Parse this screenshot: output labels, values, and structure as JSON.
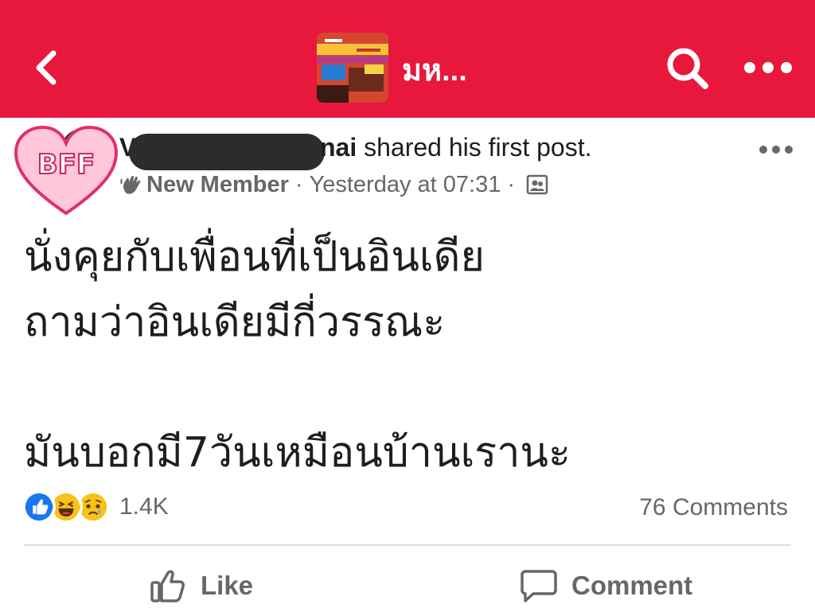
{
  "header": {
    "group_title": "มห...",
    "colors": {
      "bar": "#e8173c",
      "icon": "#ffffff"
    },
    "icons": [
      "back-chevron-icon",
      "search-icon",
      "more-icon"
    ]
  },
  "post": {
    "avatar_text": "BFF",
    "author_start": "V",
    "author_end": "nai",
    "shared_text": " shared his first post.",
    "badge": "New Member",
    "separator": "·",
    "timestamp": "Yesterday at 07:31",
    "lines": [
      "นั่งคุยกับเพื่อนที่เป็นอินเดีย",
      "ถามว่าอินเดียมีกี่วรรณะ",
      "",
      "มันบอกมี7วันเหมือนบ้านเรานะ"
    ]
  },
  "stats": {
    "reaction_count": "1.4K",
    "comments": "76 Comments",
    "reaction_icons": [
      "like-reaction-icon",
      "haha-reaction-icon",
      "sad-reaction-icon"
    ]
  },
  "actions": {
    "like_label": "Like",
    "comment_label": "Comment"
  }
}
